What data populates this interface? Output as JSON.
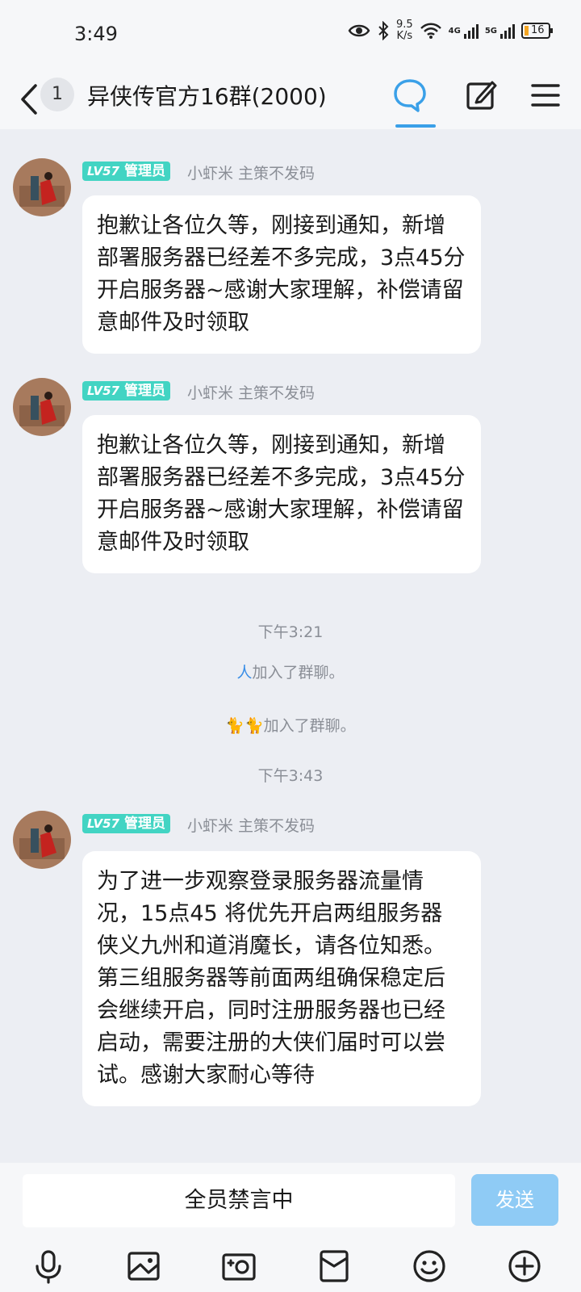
{
  "status_bar": {
    "time": "3:49",
    "net_speed_value": "9.5",
    "net_speed_unit": "K/s",
    "net_type_1": "4G",
    "net_type_2": "5G",
    "battery": "16"
  },
  "header": {
    "unread_count": "1",
    "title": "异侠传官方16群(2000)"
  },
  "messages": [
    {
      "role_level": "LV57",
      "role": "管理员",
      "sender": "小虾米 主策不发码",
      "text": "抱歉让各位久等，刚接到通知，新增部署服务器已经差不多完成，3点45分开启服务器~感谢大家理解，补偿请留意邮件及时领取"
    },
    {
      "role_level": "LV57",
      "role": "管理员",
      "sender": "小虾米 主策不发码",
      "text": "抱歉让各位久等，刚接到通知，新增部署服务器已经差不多完成，3点45分开启服务器~感谢大家理解，补偿请留意邮件及时领取"
    },
    {
      "role_level": "LV57",
      "role": "管理员",
      "sender": "小虾米 主策不发码",
      "text": "为了进一步观察登录服务器流量情况，15点45 将优先开启两组服务器 侠义九州和道消魔长，请各位知悉。第三组服务器等前面两组确保稳定后会继续开启，同时注册服务器也已经启动，需要注册的大侠们届时可以尝试。感谢大家耐心等待"
    }
  ],
  "system": {
    "time_1": "下午3:21",
    "join_1_name": "人",
    "join_1_text": "加入了群聊。",
    "join_2_name": "🐈🐈",
    "join_2_text": "加入了群聊。",
    "time_2": "下午3:43"
  },
  "input": {
    "placeholder": "全员禁言中",
    "send_label": "发送"
  },
  "colors": {
    "accent": "#3aa0e8",
    "admin_badge": "#42d4c3",
    "send_disabled": "#8fcbf5",
    "background": "#eceef3"
  }
}
